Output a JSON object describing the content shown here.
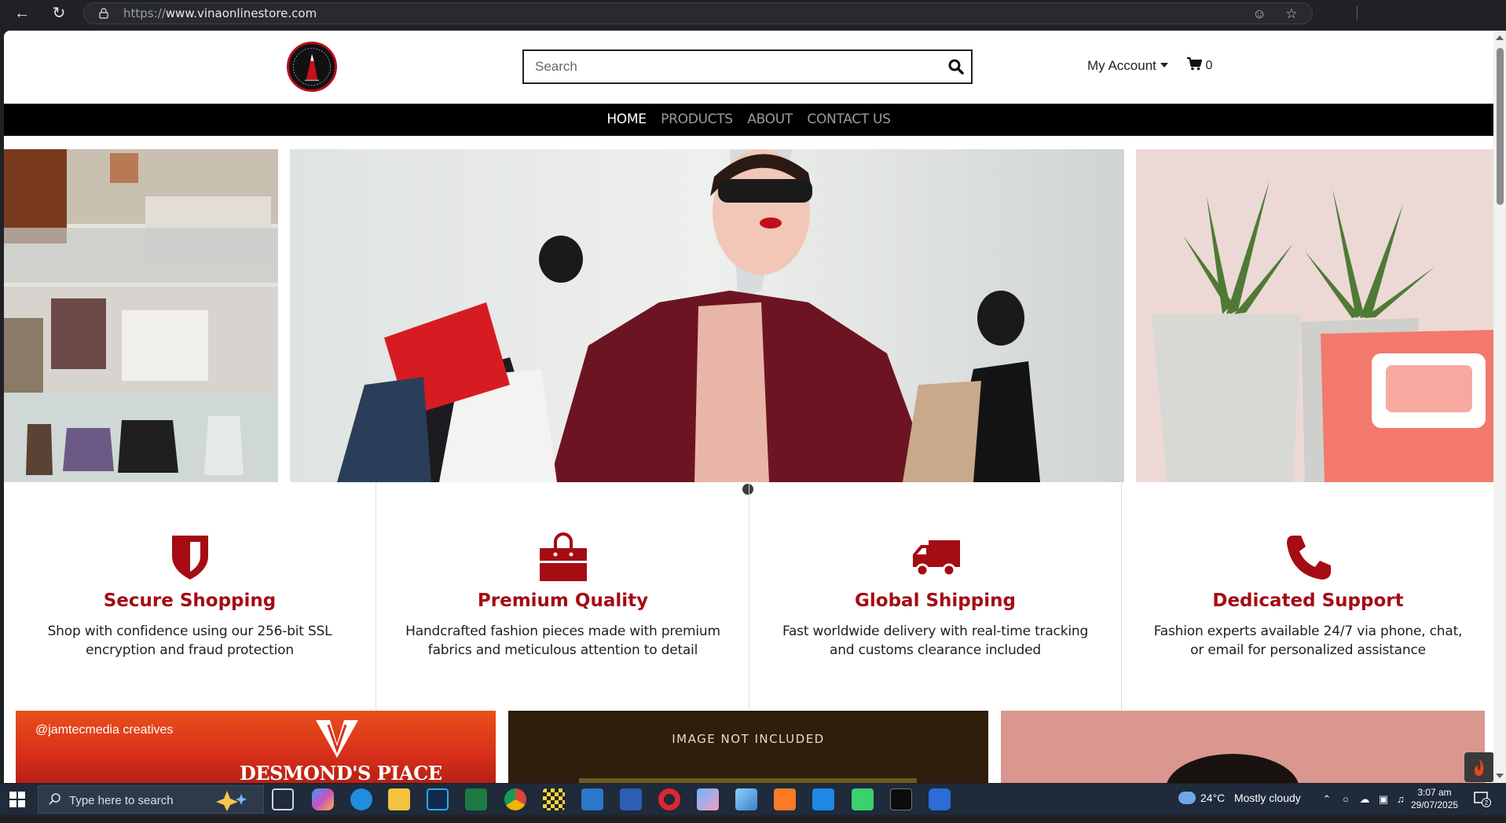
{
  "browser": {
    "url_scheme": "https://",
    "url_host": "www.vinaonlinestore.com"
  },
  "header": {
    "search_placeholder": "Search",
    "account_label": "My Account",
    "cart_count": "0"
  },
  "nav": {
    "items": [
      {
        "label": "HOME",
        "active": true
      },
      {
        "label": "PRODUCTS",
        "active": false
      },
      {
        "label": "ABOUT",
        "active": false
      },
      {
        "label": "CONTACT US",
        "active": false
      }
    ]
  },
  "carousel": {
    "slide_count": 3,
    "active_index": 1
  },
  "features": [
    {
      "icon": "shield-icon",
      "title": "Secure Shopping",
      "description": "Shop with confidence using our 256-bit SSL encryption and fraud protection"
    },
    {
      "icon": "shopping-bag-icon",
      "title": "Premium Quality",
      "description": "Handcrafted fashion pieces made with premium fabrics and meticulous attention to detail"
    },
    {
      "icon": "truck-icon",
      "title": "Global Shipping",
      "description": "Fast worldwide delivery with real-time tracking and customs clearance included"
    },
    {
      "icon": "phone-icon",
      "title": "Dedicated Support",
      "description": "Fashion experts available 24/7 via phone, chat, or email for personalized assistance"
    }
  ],
  "promos": {
    "card1_handle": "@jamtecmedia creatives",
    "card1_brand": "DESMOND'S PIACE",
    "card2_notice": "IMAGE NOT INCLUDED"
  },
  "taskbar": {
    "search_placeholder": "Type here to search",
    "temperature": "24°C",
    "weather": "Mostly cloudy",
    "time": "3:07 am",
    "date": "29/07/2025",
    "notification_count": "2"
  },
  "colors": {
    "accent": "#a50c14",
    "nav_bg": "#000000",
    "taskbar_bg": "#1f2a3a"
  }
}
